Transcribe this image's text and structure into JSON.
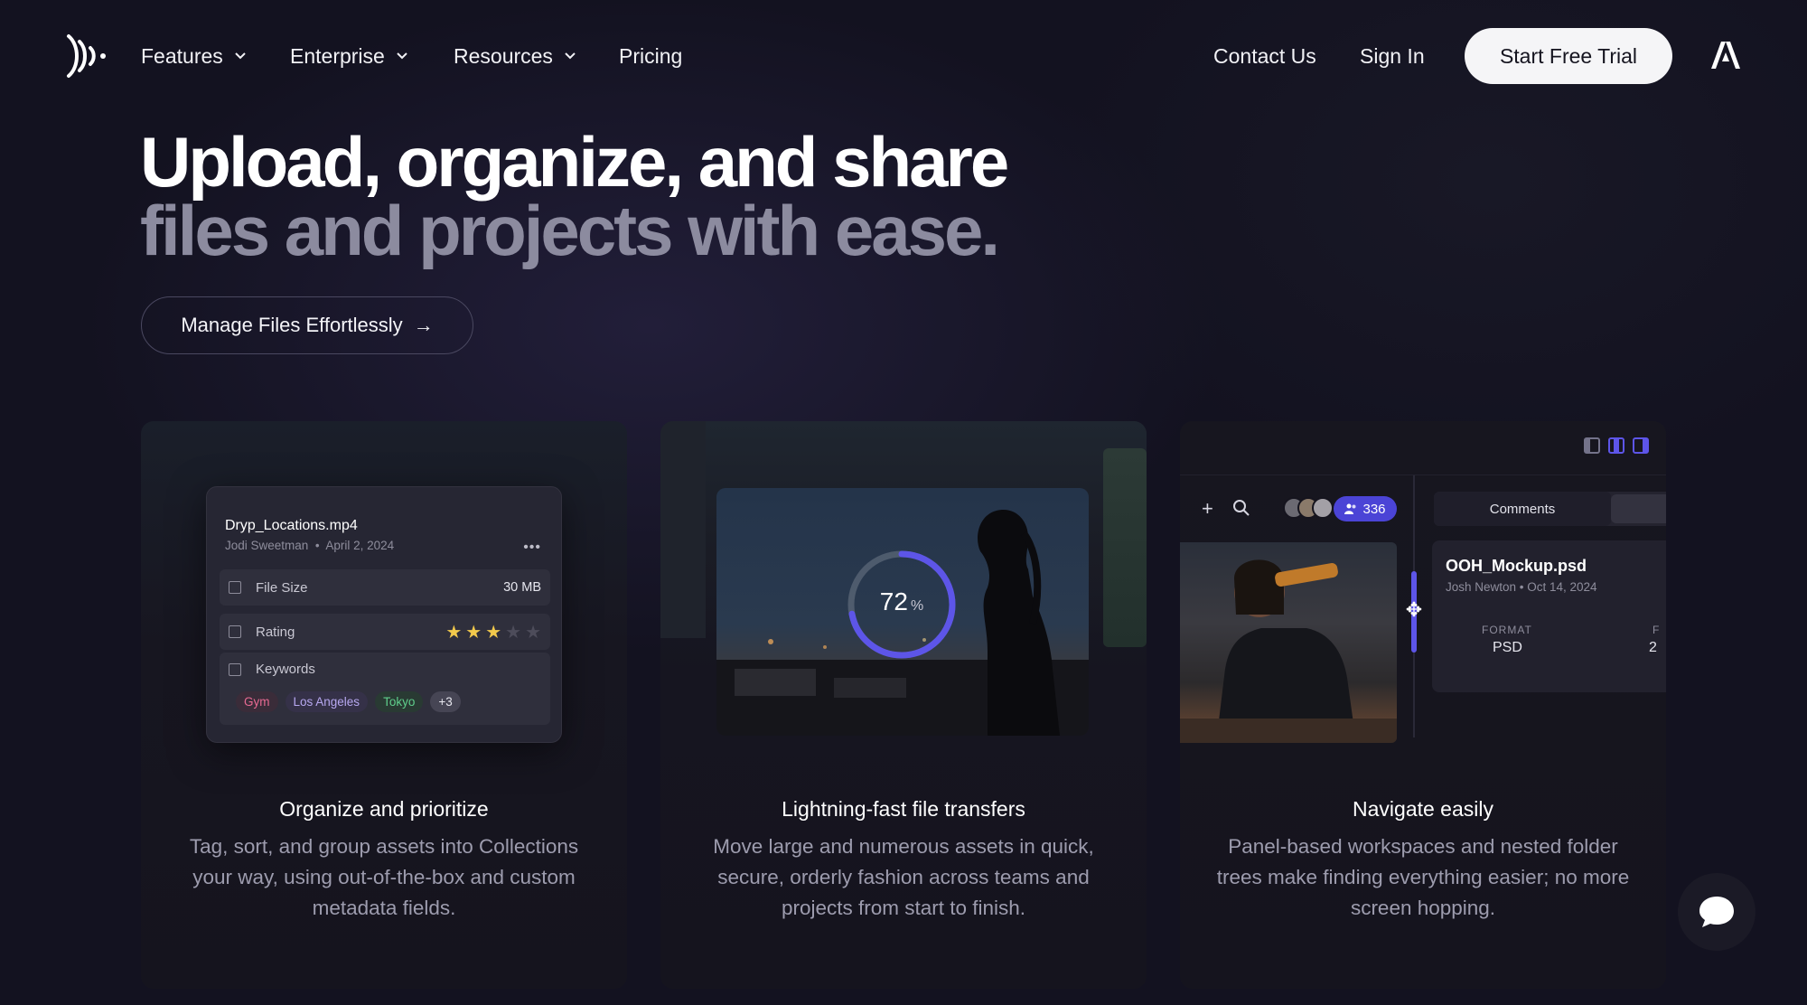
{
  "nav": {
    "features": "Features",
    "enterprise": "Enterprise",
    "resources": "Resources",
    "pricing": "Pricing",
    "contact": "Contact Us",
    "signin": "Sign In",
    "trial": "Start Free Trial"
  },
  "hero": {
    "line1": "Upload, organize, and share",
    "line2": "files and projects with ease.",
    "cta": "Manage Files Effortlessly",
    "cta_arrow": "→"
  },
  "cards": [
    {
      "title": "Organize and prioritize",
      "desc": "Tag, sort, and group assets into Collections your way, using out-of-the-box and custom metadata fields.",
      "panel": {
        "filename": "Dryp_Locations.mp4",
        "author": "Jodi Sweetman",
        "date": "April 2, 2024",
        "meta_sep": "•",
        "dots": "•••",
        "filesize_label": "File Size",
        "filesize_value": "30 MB",
        "rating_label": "Rating",
        "rating_value": 3,
        "rating_max": 5,
        "keywords_label": "Keywords",
        "keywords": [
          "Gym",
          "Los Angeles",
          "Tokyo"
        ],
        "keywords_more": "+3"
      }
    },
    {
      "title": "Lightning-fast file transfers",
      "desc": "Move large and numerous assets in quick, secure, orderly fashion across teams and projects from start to finish.",
      "progress": {
        "value": "72",
        "unit": "%",
        "fraction": 0.72
      }
    },
    {
      "title": "Navigate easily",
      "desc": "Panel-based workspaces and nested folder trees make finding everything easier; no more screen hopping.",
      "ui": {
        "plus": "+",
        "badge_count": "336",
        "tab_comments": "Comments",
        "filename": "OOH_Mockup.psd",
        "meta": "Josh Newton • Oct 14, 2024",
        "format_label": "FORMAT",
        "format_value": "PSD",
        "cut_label": "F",
        "cut_value": "2"
      }
    }
  ],
  "colors": {
    "accent": "#5d55e8",
    "background": "#131220",
    "star": "#f2c94c"
  }
}
